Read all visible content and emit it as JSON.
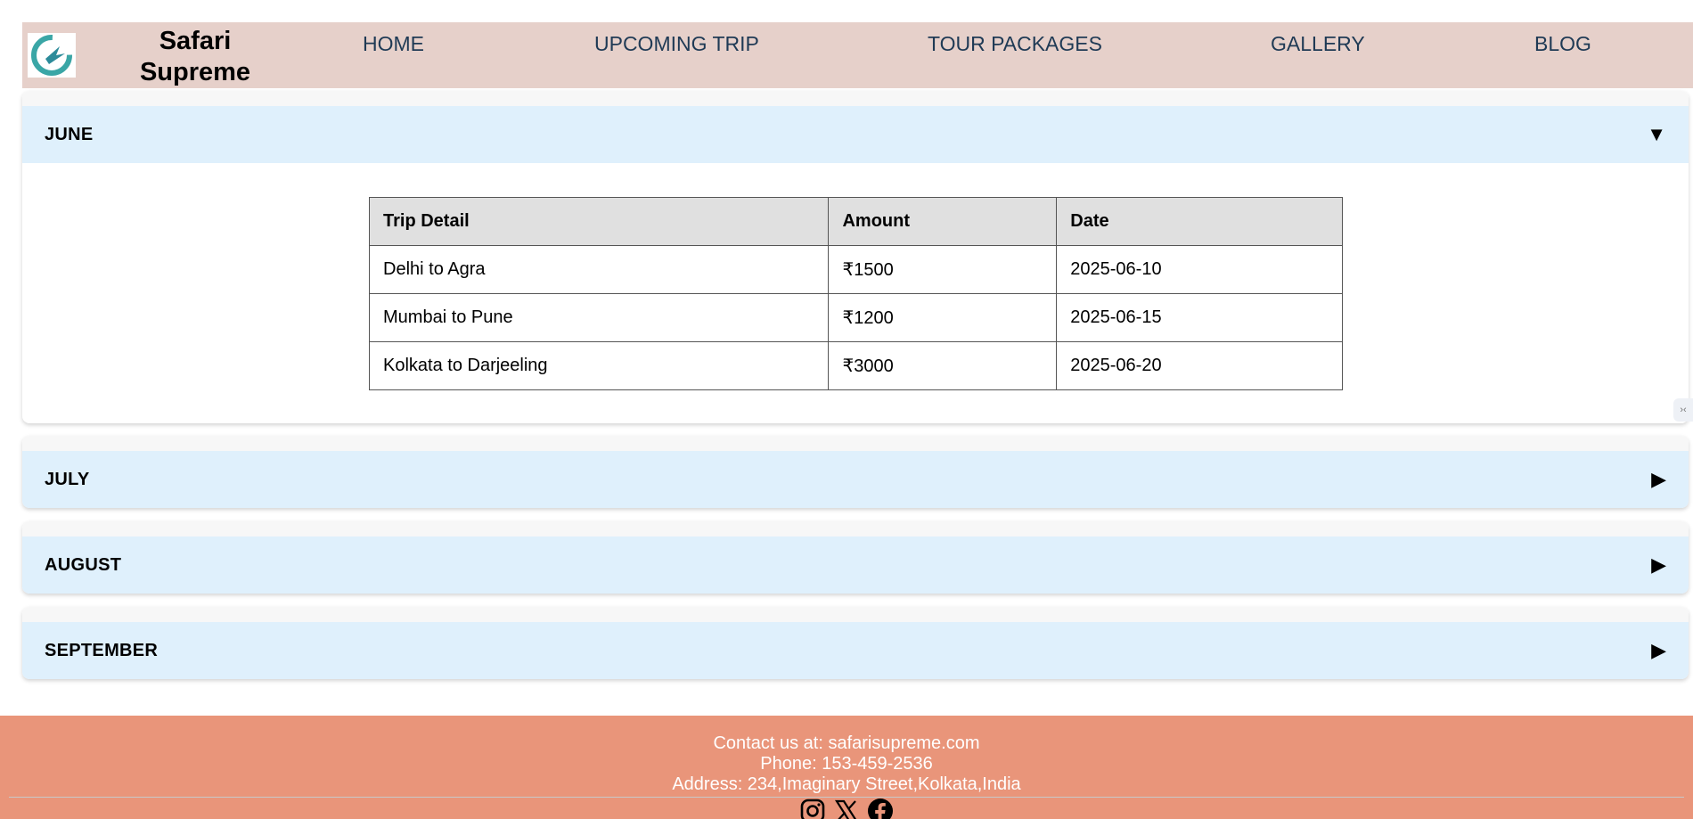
{
  "brand": {
    "line1": "Safari",
    "line2": "Supreme"
  },
  "nav": [
    "HOME",
    "UPCOMING TRIP",
    "TOUR PACKAGES",
    "GALLERY",
    "BLOG"
  ],
  "months": [
    {
      "name": "JUNE",
      "arrow": "▼",
      "expanded": true
    },
    {
      "name": "JULY",
      "arrow": "▶",
      "expanded": false
    },
    {
      "name": "AUGUST",
      "arrow": "▶",
      "expanded": false
    },
    {
      "name": "SEPTEMBER",
      "arrow": "▶",
      "expanded": false
    }
  ],
  "table": {
    "headers": [
      "Trip Detail",
      "Amount",
      "Date"
    ],
    "rows": [
      [
        "Delhi to Agra",
        "₹1500",
        "2025-06-10"
      ],
      [
        "Mumbai to Pune",
        "₹1200",
        "2025-06-15"
      ],
      [
        "Kolkata to Darjeeling",
        "₹3000",
        "2025-06-20"
      ]
    ]
  },
  "footer": {
    "contact": "Contact us at: safarisupreme.com",
    "phone": "Phone: 153-459-2536",
    "address": "Address: 234,Imaginary Street,Kolkata,India"
  },
  "side_tab": "›‹",
  "colors": {
    "header_bg": "#e6d0ca",
    "accordion_bg": "#dff0fc",
    "footer_bg": "#e9957a",
    "nav_text": "#1f3a55"
  }
}
